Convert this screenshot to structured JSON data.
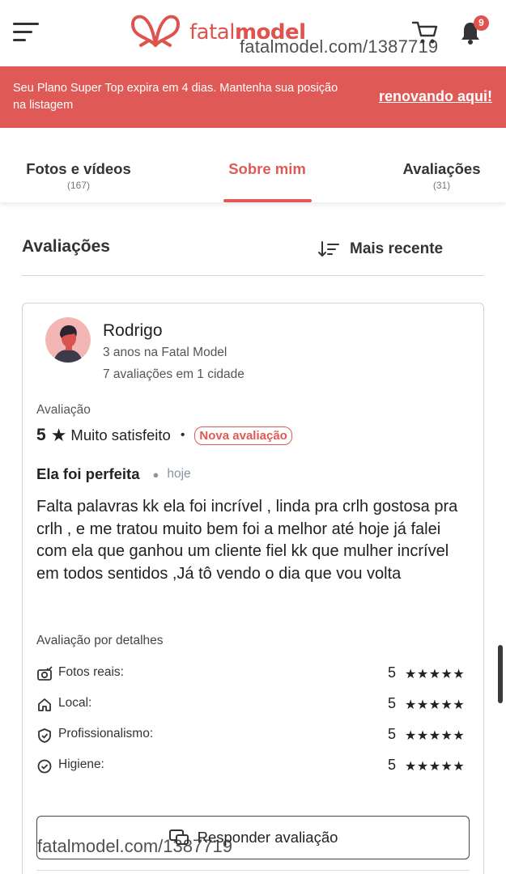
{
  "header": {
    "logo_text_light": "fatal",
    "logo_text_bold": "model",
    "notification_count": "9",
    "watermark": "fatalmodel.com/1387719"
  },
  "banner": {
    "message": "Seu Plano Super Top expira em 4 dias. Mantenha sua posição na listagem",
    "link_label": "renovando aqui!"
  },
  "tabs": [
    {
      "label": "Fotos e vídeos",
      "count": "(167)"
    },
    {
      "label": "Sobre mim",
      "count": ""
    },
    {
      "label": "Avaliações",
      "count": "(31)"
    }
  ],
  "active_tab": "Sobre mim",
  "section": {
    "title": "Avaliações",
    "sort_label": "Mais recente"
  },
  "review": {
    "reviewer_name": "Rodrigo",
    "reviewer_since": "3 anos na Fatal Model",
    "reviewer_count": "7 avaliações em 1 cidade",
    "rating_label": "Avaliação",
    "rating_value": "5",
    "rating_text": "Muito satisfeito",
    "new_badge": "Nova avaliação",
    "title": "Ela foi perfeita",
    "date": "hoje",
    "body": "Falta palavras kk ela foi incrível , linda pra crlh gostosa pra crlh , e me tratou muito bem foi a melhor até hoje já falei com ela que ganhou um cliente fiel kk que mulher incrível em todos sentidos ,Já tô vendo o dia que vou volta",
    "details_label": "Avaliação por detalhes",
    "details": [
      {
        "label": "Fotos reais:",
        "score": "5",
        "stars": "★★★★★",
        "icon": "camera-check-icon"
      },
      {
        "label": "Local:",
        "score": "5",
        "stars": "★★★★★",
        "icon": "home-icon"
      },
      {
        "label": "Profissionalismo:",
        "score": "5",
        "stars": "★★★★★",
        "icon": "shield-check-icon"
      },
      {
        "label": "Higiene:",
        "score": "5",
        "stars": "★★★★★",
        "icon": "check-circle-icon"
      }
    ],
    "reply_label": "Responder avaliação"
  },
  "colors": {
    "brand": "#df5a56",
    "text": "#222222"
  }
}
